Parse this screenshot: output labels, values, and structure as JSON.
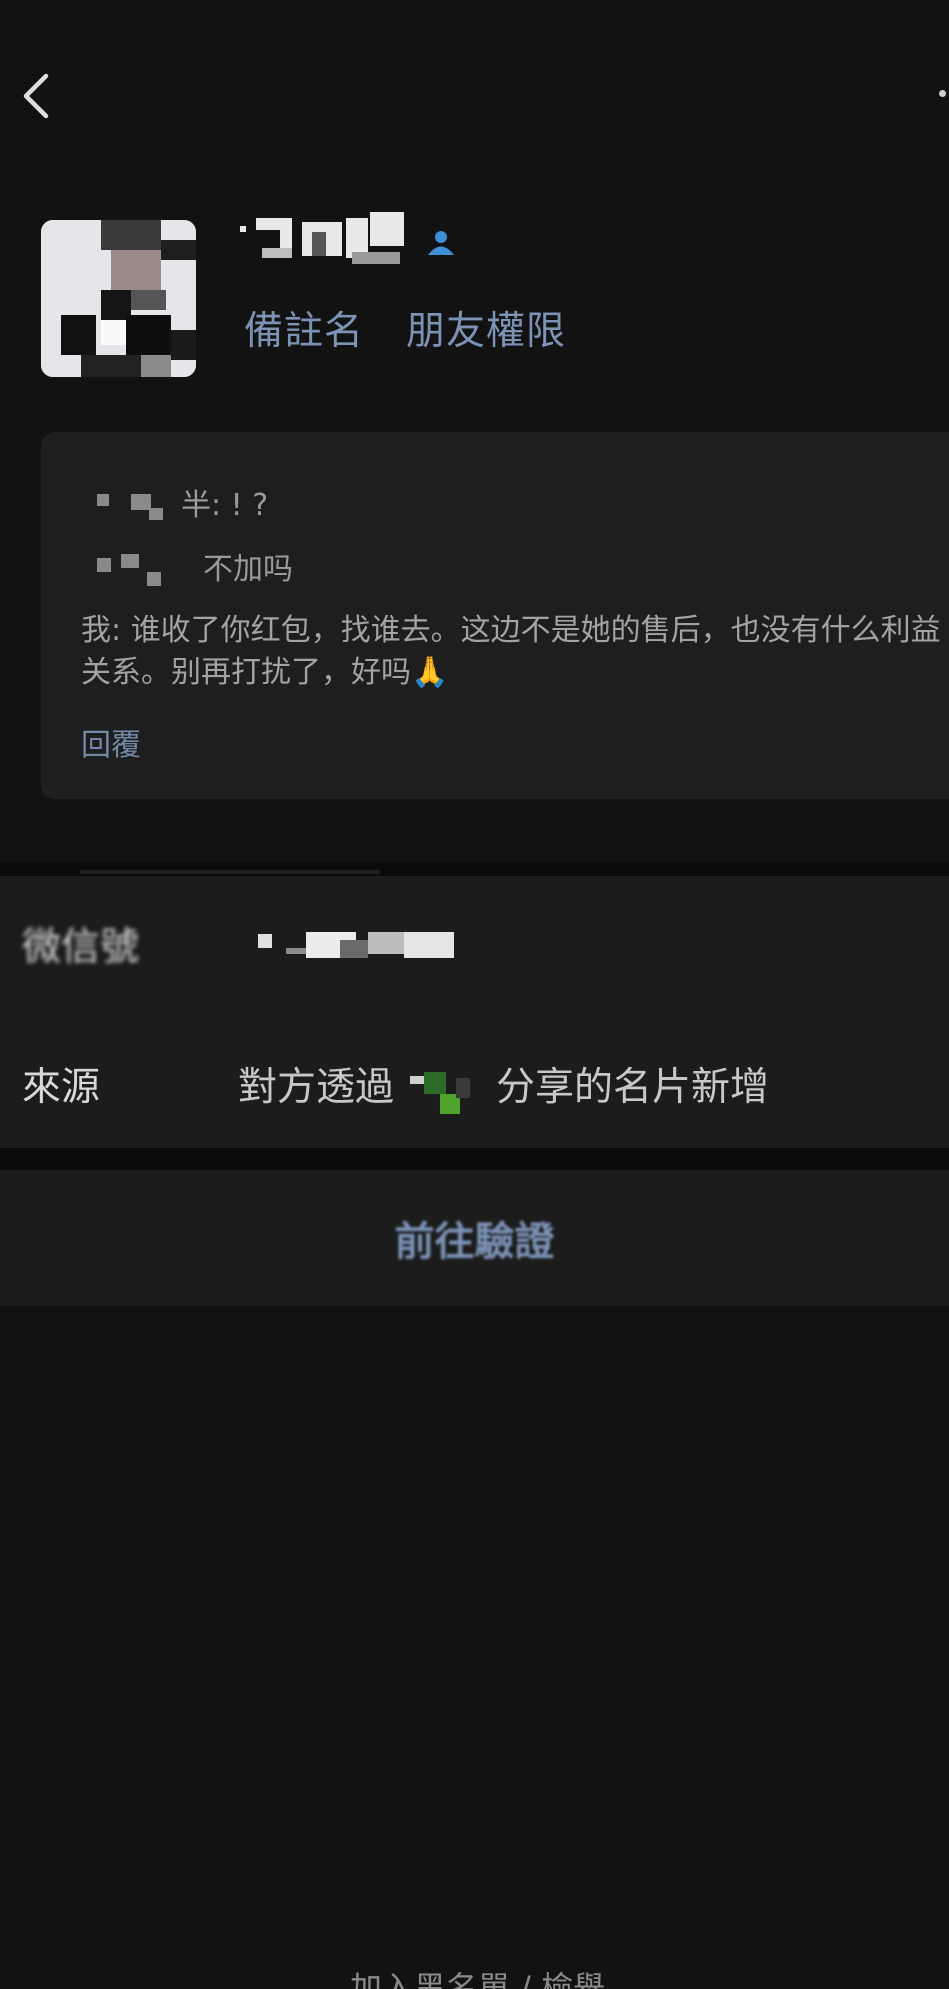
{
  "top_bar": {
    "back_icon": "chevron-left-icon",
    "more_icon": "more-dots-icon"
  },
  "profile": {
    "badge_icon": "verified-person-icon",
    "remark_label": "備註名",
    "permission_label": "朋友權限"
  },
  "greeting_card": {
    "line1_suffix": "半: ! ?",
    "line2_text": "不加吗",
    "reply_text": "我: 谁收了你红包，找谁去。这边不是她的售后，也没有什么利益关系。别再打扰了，好吗🙏",
    "reply_link": "回覆"
  },
  "info": {
    "wechat_id_label": "微信號",
    "source_label": "來源",
    "source_prefix": "對方透過",
    "source_suffix": "分享的名片新增"
  },
  "verify_button": "前往驗證",
  "bottom_hint": "加入黑名單 / 檢舉"
}
